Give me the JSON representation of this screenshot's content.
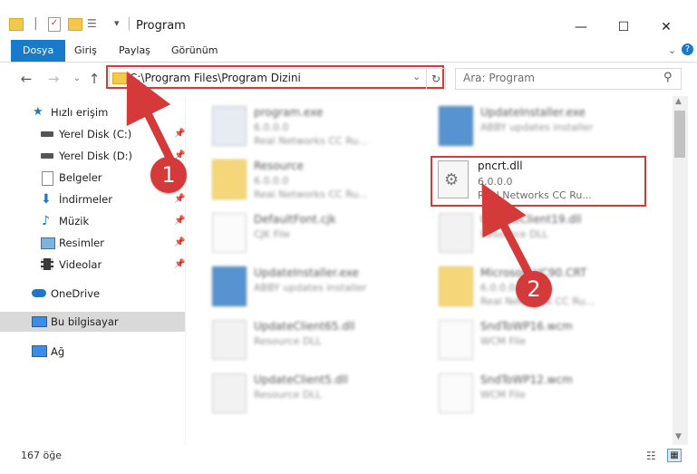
{
  "window": {
    "title": "Program",
    "controls": {
      "minimize": "—",
      "maximize": "☐",
      "close": "✕"
    }
  },
  "ribbon": {
    "tabs": [
      "Dosya",
      "Giriş",
      "Paylaş",
      "Görünüm"
    ]
  },
  "address": {
    "path": "C:\\Program Files\\Program Dizini",
    "search_placeholder": "Ara: Program"
  },
  "sidebar": {
    "items": [
      {
        "label": "Hızlı erişim",
        "icon": "star-icon"
      },
      {
        "label": "Yerel Disk (C:)",
        "icon": "drive-icon",
        "pinned": true
      },
      {
        "label": "Yerel Disk (D:)",
        "icon": "drive-icon",
        "pinned": true
      },
      {
        "label": "Belgeler",
        "icon": "documents-icon",
        "pinned": true
      },
      {
        "label": "İndirmeler",
        "icon": "download-icon",
        "pinned": true
      },
      {
        "label": "Müzik",
        "icon": "music-icon",
        "pinned": true
      },
      {
        "label": "Resimler",
        "icon": "pictures-icon",
        "pinned": true
      },
      {
        "label": "Videolar",
        "icon": "video-icon",
        "pinned": true
      },
      {
        "label": "OneDrive",
        "icon": "cloud-icon"
      },
      {
        "label": "Bu bilgisayar",
        "icon": "computer-icon"
      },
      {
        "label": "Ağ",
        "icon": "network-icon"
      }
    ]
  },
  "files": [
    {
      "name": "program.exe",
      "line1": "6.0.0.0",
      "line2": "Real Networks CC Ru...",
      "icon": "exe-icon"
    },
    {
      "name": "UpdateInstaller.exe",
      "line1": "ABBY updates installer",
      "line2": "",
      "icon": "installer-icon"
    },
    {
      "name": "Resource",
      "line1": "6.0.0.0",
      "line2": "Real Networks CC Ru...",
      "icon": "folder-icon"
    },
    {
      "name": "pncrt.dll",
      "line1": "6.0.0.0",
      "line2": "Real Networks CC Ru...",
      "icon": "dll-icon"
    },
    {
      "name": "DefaultFont.cjk",
      "line1": "CJK File",
      "line2": "",
      "icon": "file-icon"
    },
    {
      "name": "UpdateClient19.dll",
      "line1": "Resource DLL",
      "line2": "",
      "icon": "dll-icon"
    },
    {
      "name": "UpdateInstaller.exe",
      "line1": "ABBY updates installer",
      "line2": "",
      "icon": "installer-icon"
    },
    {
      "name": "Microsoft.VC90.CRT",
      "line1": "6.0.0.0",
      "line2": "Real Networks CC Ru...",
      "icon": "folder-icon"
    },
    {
      "name": "UpdateClient65.dll",
      "line1": "Resource DLL",
      "line2": "",
      "icon": "dll-icon"
    },
    {
      "name": "SndToWP16.wcm",
      "line1": "WCM File",
      "line2": "",
      "icon": "file-icon"
    },
    {
      "name": "UpdateClient5.dll",
      "line1": "Resource DLL",
      "line2": "",
      "icon": "dll-icon"
    },
    {
      "name": "SndToWP12.wcm",
      "line1": "WCM File",
      "line2": "",
      "icon": "file-icon"
    }
  ],
  "status": {
    "count": "167 öğe"
  },
  "callouts": [
    "1",
    "2"
  ],
  "colors": {
    "accent": "#1979ca",
    "highlight": "#d43a3a",
    "selected_nav": "#d9d9d9"
  }
}
